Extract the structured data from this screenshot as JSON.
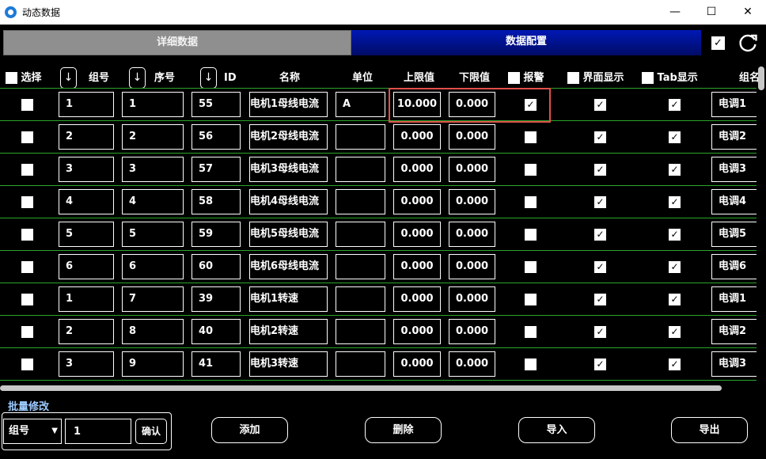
{
  "window": {
    "title": "动态数据",
    "min": "—",
    "max": "☐",
    "close": "✕"
  },
  "tabs": {
    "detail": "详细数据",
    "config": "数据配置"
  },
  "headers": {
    "select": "选择",
    "group": "组号",
    "seq": "序号",
    "id": "ID",
    "name": "名称",
    "unit": "单位",
    "upper": "上限值",
    "lower": "下限值",
    "alarm": "报警",
    "ui_display": "界面显示",
    "tab_display": "Tab显示",
    "group_name": "组名"
  },
  "rows": [
    {
      "select": false,
      "group": "1",
      "seq": "1",
      "id": "55",
      "name": "电机1母线电流",
      "unit": "A",
      "upper": "10.000",
      "lower": "0.000",
      "alarm": true,
      "ui": true,
      "tab": true,
      "group_name": "电调1"
    },
    {
      "select": false,
      "group": "2",
      "seq": "2",
      "id": "56",
      "name": "电机2母线电流",
      "unit": "",
      "upper": "0.000",
      "lower": "0.000",
      "alarm": false,
      "ui": true,
      "tab": true,
      "group_name": "电调2"
    },
    {
      "select": false,
      "group": "3",
      "seq": "3",
      "id": "57",
      "name": "电机3母线电流",
      "unit": "",
      "upper": "0.000",
      "lower": "0.000",
      "alarm": false,
      "ui": true,
      "tab": true,
      "group_name": "电调3"
    },
    {
      "select": false,
      "group": "4",
      "seq": "4",
      "id": "58",
      "name": "电机4母线电流",
      "unit": "",
      "upper": "0.000",
      "lower": "0.000",
      "alarm": false,
      "ui": true,
      "tab": true,
      "group_name": "电调4"
    },
    {
      "select": false,
      "group": "5",
      "seq": "5",
      "id": "59",
      "name": "电机5母线电流",
      "unit": "",
      "upper": "0.000",
      "lower": "0.000",
      "alarm": false,
      "ui": true,
      "tab": true,
      "group_name": "电调5"
    },
    {
      "select": false,
      "group": "6",
      "seq": "6",
      "id": "60",
      "name": "电机6母线电流",
      "unit": "",
      "upper": "0.000",
      "lower": "0.000",
      "alarm": false,
      "ui": true,
      "tab": true,
      "group_name": "电调6"
    },
    {
      "select": false,
      "group": "1",
      "seq": "7",
      "id": "39",
      "name": "电机1转速",
      "unit": "",
      "upper": "0.000",
      "lower": "0.000",
      "alarm": false,
      "ui": true,
      "tab": true,
      "group_name": "电调1"
    },
    {
      "select": false,
      "group": "2",
      "seq": "8",
      "id": "40",
      "name": "电机2转速",
      "unit": "",
      "upper": "0.000",
      "lower": "0.000",
      "alarm": false,
      "ui": true,
      "tab": true,
      "group_name": "电调2"
    },
    {
      "select": false,
      "group": "3",
      "seq": "9",
      "id": "41",
      "name": "电机3转速",
      "unit": "",
      "upper": "0.000",
      "lower": "0.000",
      "alarm": false,
      "ui": true,
      "tab": true,
      "group_name": "电调3"
    }
  ],
  "batch": {
    "label": "批量修改",
    "field": "组号",
    "value": "1",
    "confirm": "确认"
  },
  "actions": {
    "add": "添加",
    "delete": "删除",
    "import": "导入",
    "export": "导出"
  },
  "icons": {
    "sort": "arrow-down-icon",
    "refresh": "refresh-icon",
    "app": "app-logo-icon"
  },
  "colors": {
    "tab_active": "#0018b4",
    "tab_inactive": "#8f8f8f",
    "row_divider": "#2aa52a",
    "highlight": "#e0504a",
    "batch_label": "#9ecbff"
  }
}
